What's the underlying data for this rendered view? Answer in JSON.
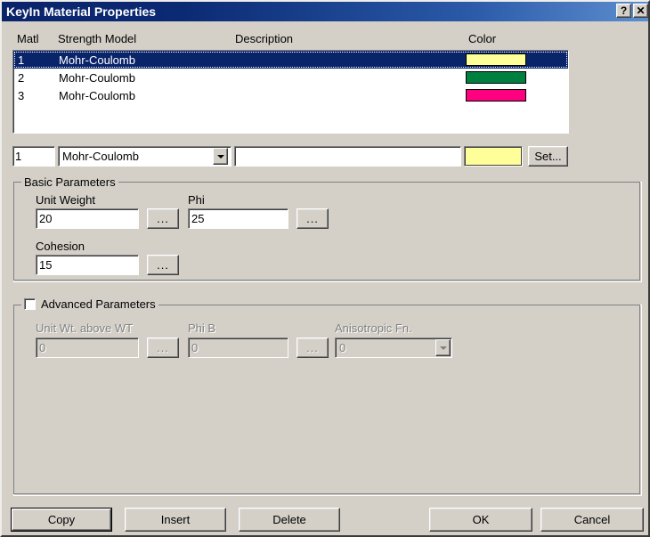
{
  "window": {
    "title": "KeyIn Material Properties",
    "help_button": "?",
    "close_button": "✕",
    "bg_color": "#d4d0c8",
    "titlebar_color": "#0a246a"
  },
  "list": {
    "columns": [
      "Matl",
      "Strength Model",
      "Description",
      "Color"
    ],
    "rows": [
      {
        "matl": "1",
        "model": "Mohr-Coulomb",
        "description": "",
        "color": "#ffff99",
        "selected": true
      },
      {
        "matl": "2",
        "model": "Mohr-Coulomb",
        "description": "",
        "color": "#008040",
        "selected": false
      },
      {
        "matl": "3",
        "model": "Mohr-Coulomb",
        "description": "",
        "color": "#ff0080",
        "selected": false
      }
    ]
  },
  "edit_row": {
    "matl_value": "1",
    "model_value": "Mohr-Coulomb",
    "model_options": [
      "Mohr-Coulomb"
    ],
    "description_value": "",
    "color_value": "#ffff99",
    "set_label": "Set..."
  },
  "basic_parameters": {
    "legend": "Basic Parameters",
    "unit_weight": {
      "label": "Unit Weight",
      "value": "20",
      "browse_label": "..."
    },
    "phi": {
      "label": "Phi",
      "value": "25",
      "browse_label": "..."
    },
    "cohesion": {
      "label": "Cohesion",
      "value": "15",
      "browse_label": "..."
    }
  },
  "advanced_parameters": {
    "legend": "Advanced Parameters",
    "checked": false,
    "unit_wt_above_wt": {
      "label": "Unit Wt. above WT",
      "value": "0",
      "browse_label": "..."
    },
    "phi_b": {
      "label": "Phi B",
      "value": "0",
      "browse_label": "..."
    },
    "anisotropic_fn": {
      "label": "Anisotropic Fn.",
      "value": "0"
    }
  },
  "buttons": {
    "copy": "Copy",
    "insert": "Insert",
    "delete": "Delete",
    "ok": "OK",
    "cancel": "Cancel"
  }
}
